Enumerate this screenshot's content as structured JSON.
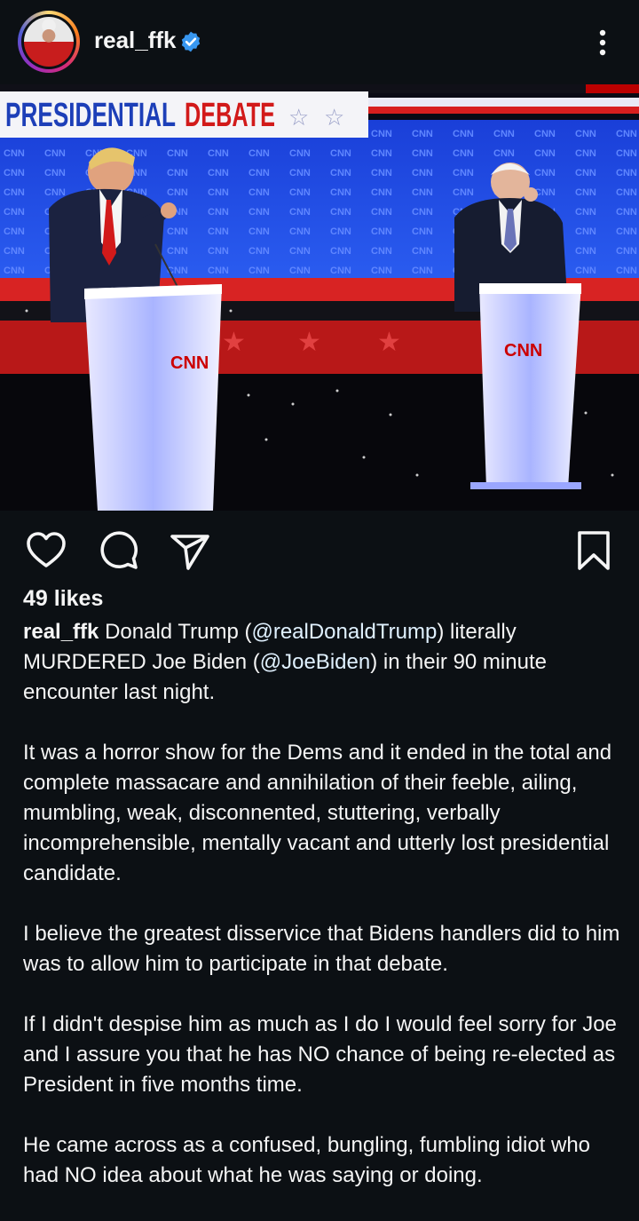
{
  "post": {
    "username": "real_ffk",
    "likes": "49 likes",
    "photo": {
      "banner_word1": "PRESIDENTIAL",
      "banner_word2": "DEBATE",
      "network_logo": "CNN"
    },
    "caption": {
      "p1_text1": "Donald Trump (",
      "p1_mention1": "@realDonaldTrump",
      "p1_text2": ") literally MURDERED Joe Biden (",
      "p1_mention2": "@JoeBiden",
      "p1_text3": ") in their 90 minute encounter last night.",
      "p2": "It was a horror show for the Dems and it ended in the total and complete massacare and annihilation of their feeble, ailing, mumbling, weak, disconnented, stuttering, verbally incomprehensible, mentally vacant and utterly lost presidential candidate.",
      "p3": "I believe the greatest disservice that Bidens handlers did to him was to allow him to participate in that debate.",
      "p4": "If I didn't despise him as much as I do I would feel sorry for Joe and I assure you that he has NO chance of being re-elected as President in five months time.",
      "p5": "He came across as a confused, bungling, fumbling idiot who had NO idea about what he was saying or doing."
    }
  },
  "icons": {
    "verified": "verified-badge-icon",
    "more": "more-vertical-icon",
    "like": "heart-icon",
    "comment": "comment-icon",
    "share": "send-icon",
    "save": "bookmark-icon"
  },
  "colors": {
    "background": "#0c1014",
    "verified": "#3897f0",
    "mention": "#e0f1ff",
    "cnn_red": "#cc0000"
  }
}
